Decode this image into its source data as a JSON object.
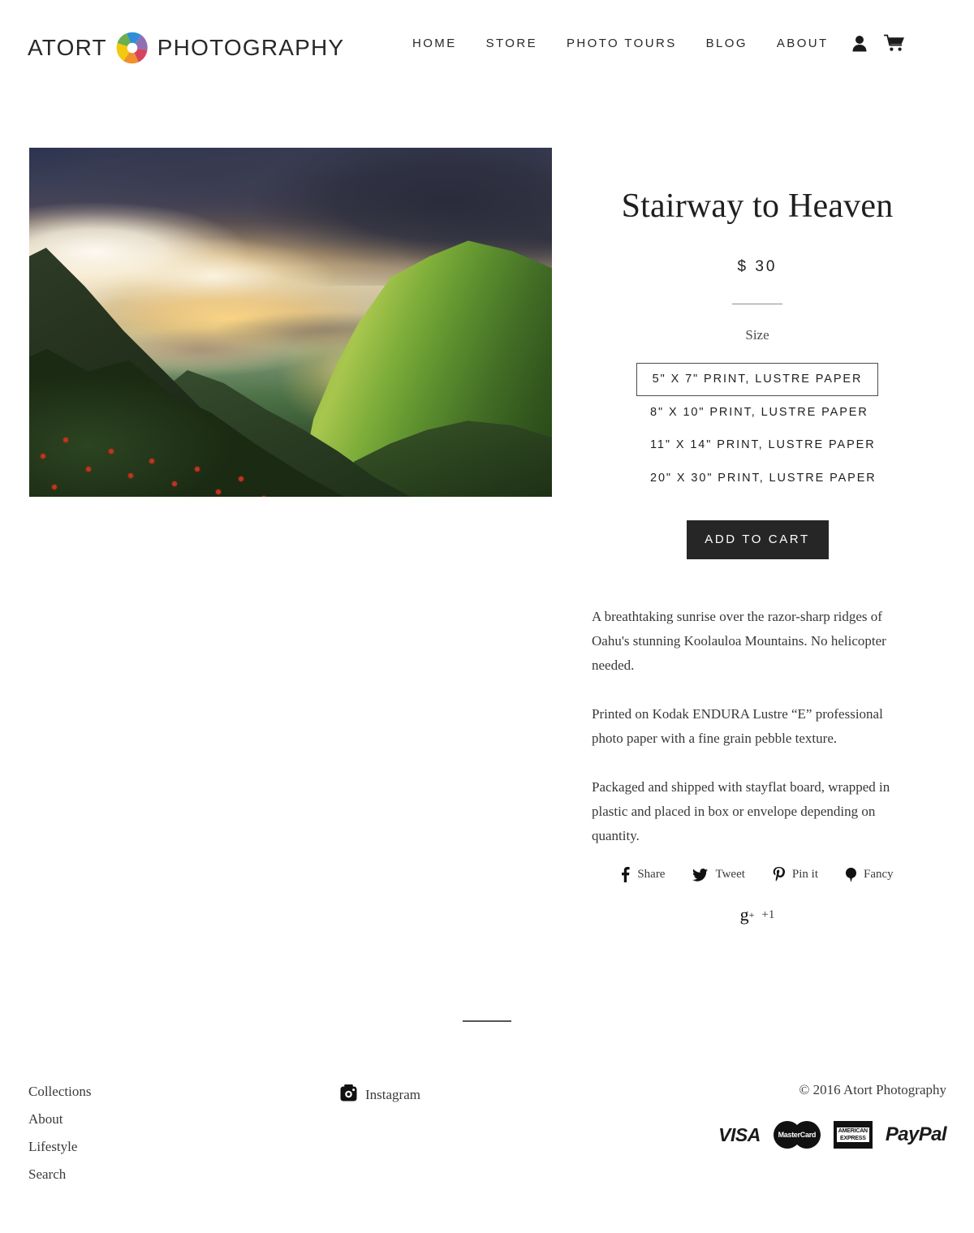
{
  "header": {
    "logo": {
      "word_left": "ATORT",
      "word_right": "PHOTOGRAPHY",
      "icon": "aperture-icon",
      "blade_colors": [
        "#6ab04c",
        "#2f8fd4",
        "#8e6fb5",
        "#d6455f",
        "#f0912b",
        "#f2c811"
      ]
    },
    "nav": [
      {
        "label": "HOME",
        "name": "nav-home"
      },
      {
        "label": "STORE",
        "name": "nav-store"
      },
      {
        "label": "PHOTO TOURS",
        "name": "nav-photo-tours"
      },
      {
        "label": "BLOG",
        "name": "nav-blog"
      },
      {
        "label": "ABOUT",
        "name": "nav-about"
      }
    ],
    "account_icon": "user-icon",
    "cart_icon": "shopping-cart-icon"
  },
  "product": {
    "image_alt": "Sunrise over green razor-sharp mountain ridges with storm clouds",
    "title": "Stairway to Heaven",
    "price": "$ 30",
    "size_label": "Size",
    "sizes": [
      {
        "label": "5\" X 7\" PRINT, LUSTRE PAPER",
        "selected": true
      },
      {
        "label": "8\" X 10\" PRINT, LUSTRE PAPER",
        "selected": false
      },
      {
        "label": "11\" X 14\" PRINT, LUSTRE PAPER",
        "selected": false
      },
      {
        "label": "20\" X 30\" PRINT, LUSTRE PAPER",
        "selected": false
      }
    ],
    "add_to_cart_label": "ADD TO CART",
    "description": [
      "A breathtaking sunrise over the razor-sharp ridges of Oahu's stunning Koolauloa Mountains. No helicopter needed.",
      "Printed on Kodak ENDURA Lustre “E” professional photo paper with a fine grain pebble texture.",
      "Packaged and shipped with stayflat board, wrapped in plastic and placed in box or envelope depending on quantity."
    ]
  },
  "share": {
    "row1": [
      {
        "label": "Share",
        "icon": "facebook-icon"
      },
      {
        "label": "Tweet",
        "icon": "twitter-icon"
      },
      {
        "label": "Pin it",
        "icon": "pinterest-icon"
      },
      {
        "label": "Fancy",
        "icon": "fancy-icon"
      }
    ],
    "row2": [
      {
        "label": "+1",
        "icon": "google-plus-icon"
      }
    ]
  },
  "footer": {
    "links": [
      {
        "label": "Collections"
      },
      {
        "label": "About"
      },
      {
        "label": "Lifestyle"
      },
      {
        "label": "Search"
      }
    ],
    "social": {
      "label": "Instagram",
      "icon": "instagram-icon"
    },
    "copyright": "© 2016 Atort Photography",
    "payments": [
      {
        "name": "visa",
        "label": "VISA"
      },
      {
        "name": "mastercard",
        "label": "MasterCard"
      },
      {
        "name": "american-express",
        "label_top": "AMERICAN",
        "label_bottom": "EXPRESS"
      },
      {
        "name": "paypal",
        "label": "PayPal"
      }
    ]
  }
}
